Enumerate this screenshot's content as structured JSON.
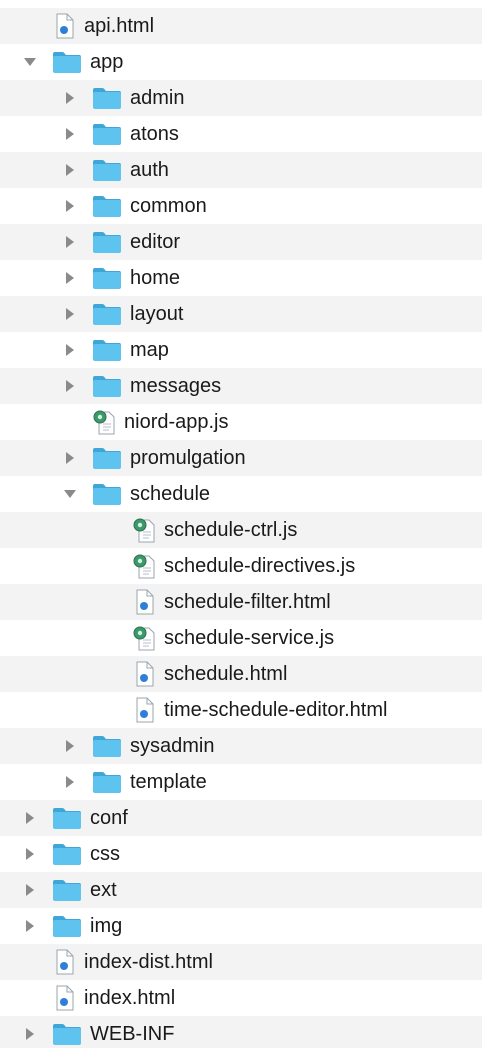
{
  "tree": {
    "rows": [
      {
        "label": "api.html",
        "kind": "html",
        "depth": 0,
        "disclosure": "none",
        "icon": "html-file-icon"
      },
      {
        "label": "app",
        "kind": "folder",
        "depth": 0,
        "disclosure": "expanded",
        "icon": "folder-icon"
      },
      {
        "label": "admin",
        "kind": "folder",
        "depth": 1,
        "disclosure": "collapsed",
        "icon": "folder-icon"
      },
      {
        "label": "atons",
        "kind": "folder",
        "depth": 1,
        "disclosure": "collapsed",
        "icon": "folder-icon"
      },
      {
        "label": "auth",
        "kind": "folder",
        "depth": 1,
        "disclosure": "collapsed",
        "icon": "folder-icon"
      },
      {
        "label": "common",
        "kind": "folder",
        "depth": 1,
        "disclosure": "collapsed",
        "icon": "folder-icon"
      },
      {
        "label": "editor",
        "kind": "folder",
        "depth": 1,
        "disclosure": "collapsed",
        "icon": "folder-icon"
      },
      {
        "label": "home",
        "kind": "folder",
        "depth": 1,
        "disclosure": "collapsed",
        "icon": "folder-icon"
      },
      {
        "label": "layout",
        "kind": "folder",
        "depth": 1,
        "disclosure": "collapsed",
        "icon": "folder-icon"
      },
      {
        "label": "map",
        "kind": "folder",
        "depth": 1,
        "disclosure": "collapsed",
        "icon": "folder-icon"
      },
      {
        "label": "messages",
        "kind": "folder",
        "depth": 1,
        "disclosure": "collapsed",
        "icon": "folder-icon"
      },
      {
        "label": "niord-app.js",
        "kind": "js",
        "depth": 1,
        "disclosure": "none",
        "icon": "js-file-icon"
      },
      {
        "label": "promulgation",
        "kind": "folder",
        "depth": 1,
        "disclosure": "collapsed",
        "icon": "folder-icon"
      },
      {
        "label": "schedule",
        "kind": "folder",
        "depth": 1,
        "disclosure": "expanded",
        "icon": "folder-icon"
      },
      {
        "label": "schedule-ctrl.js",
        "kind": "js",
        "depth": 2,
        "disclosure": "none",
        "icon": "js-file-icon"
      },
      {
        "label": "schedule-directives.js",
        "kind": "js",
        "depth": 2,
        "disclosure": "none",
        "icon": "js-file-icon"
      },
      {
        "label": "schedule-filter.html",
        "kind": "html",
        "depth": 2,
        "disclosure": "none",
        "icon": "html-file-icon"
      },
      {
        "label": "schedule-service.js",
        "kind": "js",
        "depth": 2,
        "disclosure": "none",
        "icon": "js-file-icon"
      },
      {
        "label": "schedule.html",
        "kind": "html",
        "depth": 2,
        "disclosure": "none",
        "icon": "html-file-icon"
      },
      {
        "label": "time-schedule-editor.html",
        "kind": "html",
        "depth": 2,
        "disclosure": "none",
        "icon": "html-file-icon"
      },
      {
        "label": "sysadmin",
        "kind": "folder",
        "depth": 1,
        "disclosure": "collapsed",
        "icon": "folder-icon"
      },
      {
        "label": "template",
        "kind": "folder",
        "depth": 1,
        "disclosure": "collapsed",
        "icon": "folder-icon"
      },
      {
        "label": "conf",
        "kind": "folder",
        "depth": 0,
        "disclosure": "collapsed",
        "icon": "folder-icon"
      },
      {
        "label": "css",
        "kind": "folder",
        "depth": 0,
        "disclosure": "collapsed",
        "icon": "folder-icon"
      },
      {
        "label": "ext",
        "kind": "folder",
        "depth": 0,
        "disclosure": "collapsed",
        "icon": "folder-icon"
      },
      {
        "label": "img",
        "kind": "folder",
        "depth": 0,
        "disclosure": "collapsed",
        "icon": "folder-icon"
      },
      {
        "label": "index-dist.html",
        "kind": "html",
        "depth": 0,
        "disclosure": "none",
        "icon": "html-file-icon"
      },
      {
        "label": "index.html",
        "kind": "html",
        "depth": 0,
        "disclosure": "none",
        "icon": "html-file-icon"
      },
      {
        "label": "WEB-INF",
        "kind": "folder",
        "depth": 0,
        "disclosure": "collapsed",
        "icon": "folder-icon"
      }
    ]
  },
  "colors": {
    "folder": "#5ec3ef",
    "folder_tab": "#3fa7d8",
    "row_alt": "#f3f3f3",
    "disclosure": "#8a8a8a",
    "text": "#1a1a1a",
    "html_dot": "#2e7fd6",
    "js_gear": "#3a9a6a"
  }
}
